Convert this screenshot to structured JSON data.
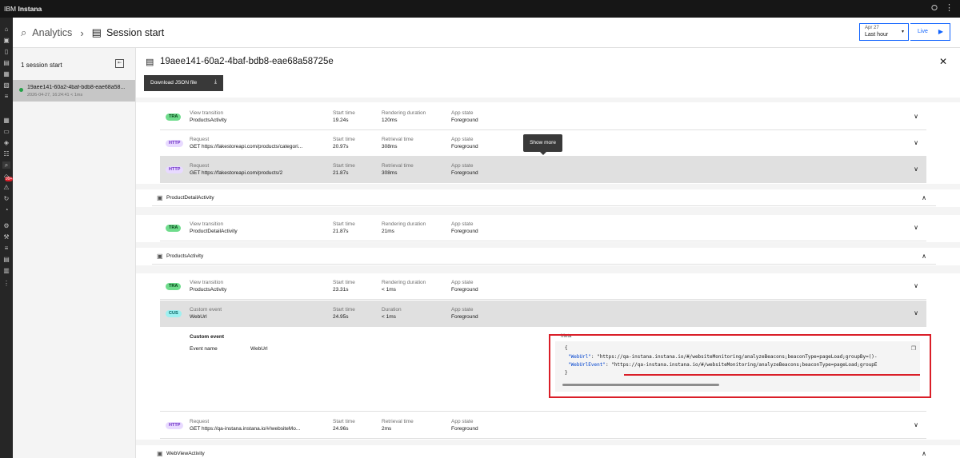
{
  "topbar": {
    "brand_prefix": "IBM",
    "brand_name": "Instana",
    "share_icon": "share-icon",
    "more_icon": "overflow-menu-icon"
  },
  "header": {
    "analytics": "Analytics",
    "title": "Session start"
  },
  "datepicker": {
    "date": "Apr 27",
    "range": "Last hour",
    "live": "Live"
  },
  "left": {
    "count": "1 session start",
    "session": {
      "id": "19aee141-60a2-4baf-bdb8-eae68a58...",
      "meta": "2026-04-27, 16:24:41  < 1ms"
    }
  },
  "main": {
    "title": "19aee141-60a2-4baf-bdb8-eae68a58725e",
    "download": "Download JSON file",
    "tooltip": "Show more"
  },
  "rows": [
    {
      "tag": "TRA",
      "l1": "View transition",
      "l2": "ProductsActivity",
      "c1": "Start time",
      "v1": "19.24s",
      "c2": "Rendering duration",
      "v2": "120ms",
      "c3": "App state",
      "v3": "Foreground"
    },
    {
      "tag": "HTTP",
      "l1": "Request",
      "l2": "GET https://fakestoreapi.com/products/categori...",
      "c1": "Start time",
      "v1": "20.97s",
      "c2": "Retrieval time",
      "v2": "308ms",
      "c3": "App state",
      "v3": "Foreground"
    },
    {
      "tag": "HTTP",
      "l1": "Request",
      "l2": "GET https://fakestoreapi.com/products/2",
      "c1": "Start time",
      "v1": "21.87s",
      "c2": "Retrieval time",
      "v2": "308ms",
      "c3": "App state",
      "v3": "Foreground"
    },
    {
      "tag": "TRA",
      "l1": "View transition",
      "l2": "ProductDetailActivity",
      "c1": "Start time",
      "v1": "21.87s",
      "c2": "Rendering duration",
      "v2": "21ms",
      "c3": "App state",
      "v3": "Foreground"
    },
    {
      "tag": "TRA",
      "l1": "View transition",
      "l2": "ProductsActivity",
      "c1": "Start time",
      "v1": "23.31s",
      "c2": "Rendering duration",
      "v2": "< 1ms",
      "c3": "App state",
      "v3": "Foreground"
    },
    {
      "tag": "CUS",
      "l1": "Custom event",
      "l2": "WebUrl",
      "c1": "Start time",
      "v1": "24.95s",
      "c2": "Duration",
      "v2": "< 1ms",
      "c3": "App state",
      "v3": "Foreground"
    },
    {
      "tag": "HTTP",
      "l1": "Request",
      "l2": "GET https://qa-instana.instana.io/#/websiteMo...",
      "c1": "Start time",
      "v1": "24.96s",
      "c2": "Retrieval time",
      "v2": "2ms",
      "c3": "App state",
      "v3": "Foreground"
    }
  ],
  "groups": [
    {
      "name": "ProductDetailActivity"
    },
    {
      "name": "ProductsActivity"
    },
    {
      "name": "WebViewActivity"
    }
  ],
  "detail": {
    "heading": "Custom event",
    "key": "Event name",
    "value": "WebUrl",
    "meta_label": "Meta",
    "code": {
      "open": "{",
      "k1": "\"WebUrl\"",
      "v1": ": \"https://qa-instana.instana.io/#/websiteMonitoring/analyzeBeacons;beaconType=pageLoad;groupBy=()-",
      "k2": "\"WebUrlEvent\"",
      "v2": ": \"https://qa-instana.instana.io/#/websiteMonitoring/analyzeBeacons;beaconType=pageLoad;groupE",
      "close": "}"
    }
  },
  "colors": {
    "highlight": "#da1e28",
    "accent": "#0f62fe",
    "selected_row": "#e0e0e0"
  }
}
